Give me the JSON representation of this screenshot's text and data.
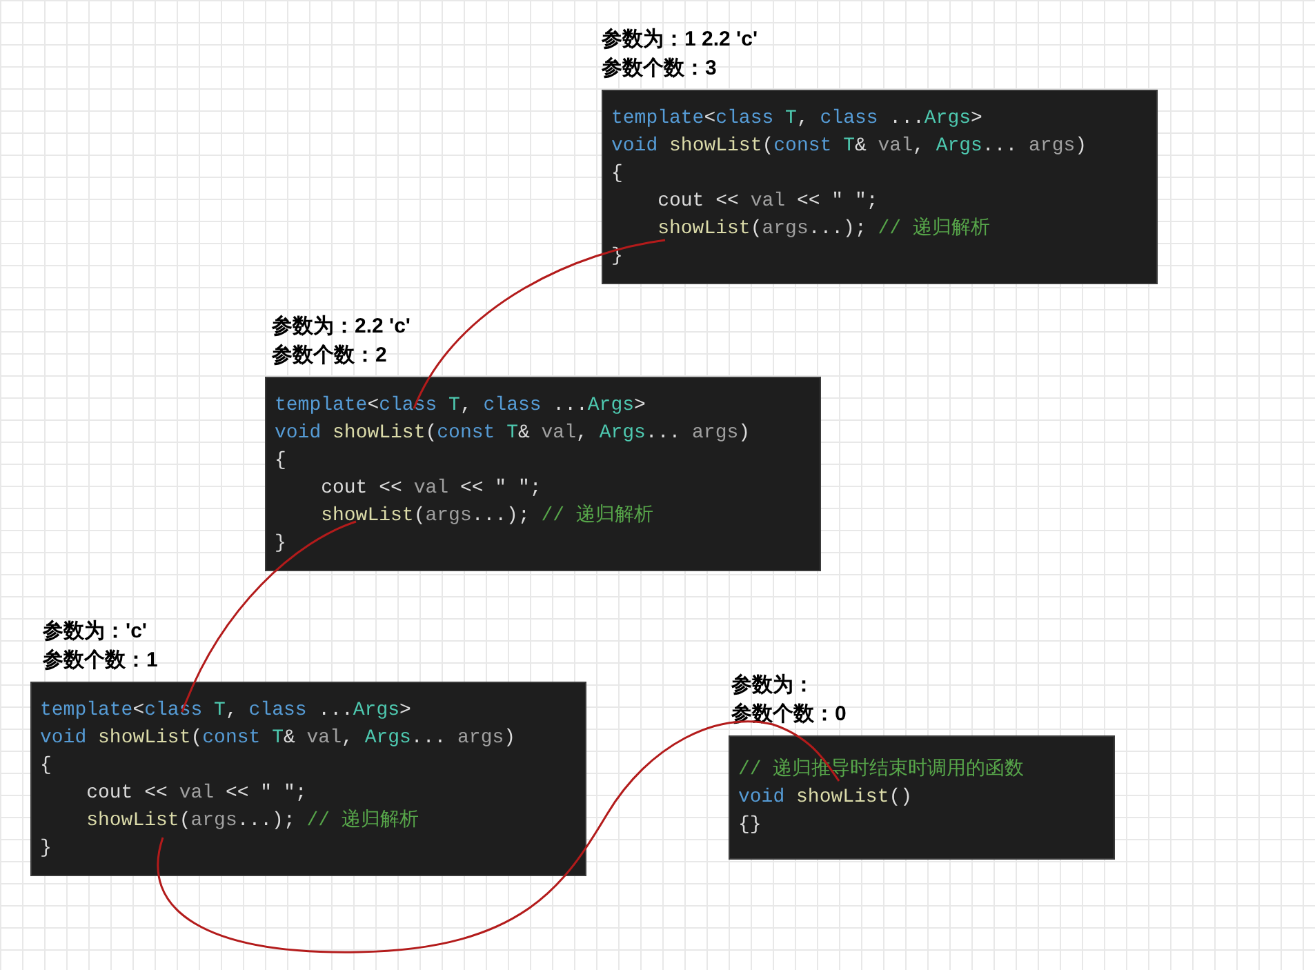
{
  "blocks": [
    {
      "args_label": "参数为：1 2.2 'c'",
      "count_label": "参数个数：3",
      "code": [
        [
          {
            "kind": "kw",
            "text": "template"
          },
          {
            "kind": "plain",
            "text": "<"
          },
          {
            "kind": "kw",
            "text": "class"
          },
          {
            "kind": "type",
            "text": " T"
          },
          {
            "kind": "plain",
            "text": ", "
          },
          {
            "kind": "kw",
            "text": "class"
          },
          {
            "kind": "plain",
            "text": " ..."
          },
          {
            "kind": "type",
            "text": "Args"
          },
          {
            "kind": "plain",
            "text": ">"
          }
        ],
        [
          {
            "kind": "kw",
            "text": "void "
          },
          {
            "kind": "fn",
            "text": "showList"
          },
          {
            "kind": "plain",
            "text": "("
          },
          {
            "kind": "kw",
            "text": "const "
          },
          {
            "kind": "type",
            "text": "T"
          },
          {
            "kind": "plain",
            "text": "& "
          },
          {
            "kind": "id",
            "text": "val"
          },
          {
            "kind": "plain",
            "text": ", "
          },
          {
            "kind": "type",
            "text": "Args"
          },
          {
            "kind": "plain",
            "text": "... "
          },
          {
            "kind": "id",
            "text": "args"
          },
          {
            "kind": "plain",
            "text": ")"
          }
        ],
        [
          {
            "kind": "plain",
            "text": "{"
          }
        ],
        [
          {
            "kind": "plain",
            "text": "    cout << "
          },
          {
            "kind": "id",
            "text": "val"
          },
          {
            "kind": "plain",
            "text": " << \" \";"
          }
        ],
        [
          {
            "kind": "fn",
            "text": "    showList"
          },
          {
            "kind": "plain",
            "text": "("
          },
          {
            "kind": "id",
            "text": "args"
          },
          {
            "kind": "plain",
            "text": "...); "
          },
          {
            "kind": "comment",
            "text": "// 递归解析"
          }
        ],
        [
          {
            "kind": "plain",
            "text": "}"
          }
        ]
      ]
    },
    {
      "args_label": "参数为：2.2 'c'",
      "count_label": "参数个数：2",
      "code": [
        [
          {
            "kind": "kw",
            "text": "template"
          },
          {
            "kind": "plain",
            "text": "<"
          },
          {
            "kind": "kw",
            "text": "class"
          },
          {
            "kind": "type",
            "text": " T"
          },
          {
            "kind": "plain",
            "text": ", "
          },
          {
            "kind": "kw",
            "text": "class"
          },
          {
            "kind": "plain",
            "text": " ..."
          },
          {
            "kind": "type",
            "text": "Args"
          },
          {
            "kind": "plain",
            "text": ">"
          }
        ],
        [
          {
            "kind": "kw",
            "text": "void "
          },
          {
            "kind": "fn",
            "text": "showList"
          },
          {
            "kind": "plain",
            "text": "("
          },
          {
            "kind": "kw",
            "text": "const "
          },
          {
            "kind": "type",
            "text": "T"
          },
          {
            "kind": "plain",
            "text": "& "
          },
          {
            "kind": "id",
            "text": "val"
          },
          {
            "kind": "plain",
            "text": ", "
          },
          {
            "kind": "type",
            "text": "Args"
          },
          {
            "kind": "plain",
            "text": "... "
          },
          {
            "kind": "id",
            "text": "args"
          },
          {
            "kind": "plain",
            "text": ")"
          }
        ],
        [
          {
            "kind": "plain",
            "text": "{"
          }
        ],
        [
          {
            "kind": "plain",
            "text": "    cout << "
          },
          {
            "kind": "id",
            "text": "val"
          },
          {
            "kind": "plain",
            "text": " << \" \";"
          }
        ],
        [
          {
            "kind": "fn",
            "text": "    showList"
          },
          {
            "kind": "plain",
            "text": "("
          },
          {
            "kind": "id",
            "text": "args"
          },
          {
            "kind": "plain",
            "text": "...); "
          },
          {
            "kind": "comment",
            "text": "// 递归解析"
          }
        ],
        [
          {
            "kind": "plain",
            "text": "}"
          }
        ]
      ]
    },
    {
      "args_label": "参数为：'c'",
      "count_label": "参数个数：1",
      "code": [
        [
          {
            "kind": "kw",
            "text": "template"
          },
          {
            "kind": "plain",
            "text": "<"
          },
          {
            "kind": "kw",
            "text": "class"
          },
          {
            "kind": "type",
            "text": " T"
          },
          {
            "kind": "plain",
            "text": ", "
          },
          {
            "kind": "kw",
            "text": "class"
          },
          {
            "kind": "plain",
            "text": " ..."
          },
          {
            "kind": "type",
            "text": "Args"
          },
          {
            "kind": "plain",
            "text": ">"
          }
        ],
        [
          {
            "kind": "kw",
            "text": "void "
          },
          {
            "kind": "fn",
            "text": "showList"
          },
          {
            "kind": "plain",
            "text": "("
          },
          {
            "kind": "kw",
            "text": "const "
          },
          {
            "kind": "type",
            "text": "T"
          },
          {
            "kind": "plain",
            "text": "& "
          },
          {
            "kind": "id",
            "text": "val"
          },
          {
            "kind": "plain",
            "text": ", "
          },
          {
            "kind": "type",
            "text": "Args"
          },
          {
            "kind": "plain",
            "text": "... "
          },
          {
            "kind": "id",
            "text": "args"
          },
          {
            "kind": "plain",
            "text": ")"
          }
        ],
        [
          {
            "kind": "plain",
            "text": "{"
          }
        ],
        [
          {
            "kind": "plain",
            "text": "    cout << "
          },
          {
            "kind": "id",
            "text": "val"
          },
          {
            "kind": "plain",
            "text": " << \" \";"
          }
        ],
        [
          {
            "kind": "fn",
            "text": "    showList"
          },
          {
            "kind": "plain",
            "text": "("
          },
          {
            "kind": "id",
            "text": "args"
          },
          {
            "kind": "plain",
            "text": "...); "
          },
          {
            "kind": "comment",
            "text": "// 递归解析"
          }
        ],
        [
          {
            "kind": "plain",
            "text": "}"
          }
        ]
      ]
    },
    {
      "args_label": "参数为：",
      "count_label": "参数个数：0",
      "code": [
        [
          {
            "kind": "comment",
            "text": "// 递归推导时结束时调用的函数"
          }
        ],
        [
          {
            "kind": "kw",
            "text": "void "
          },
          {
            "kind": "fn",
            "text": "showList"
          },
          {
            "kind": "plain",
            "text": "()"
          }
        ],
        [
          {
            "kind": "plain",
            "text": "{}"
          }
        ]
      ]
    }
  ]
}
